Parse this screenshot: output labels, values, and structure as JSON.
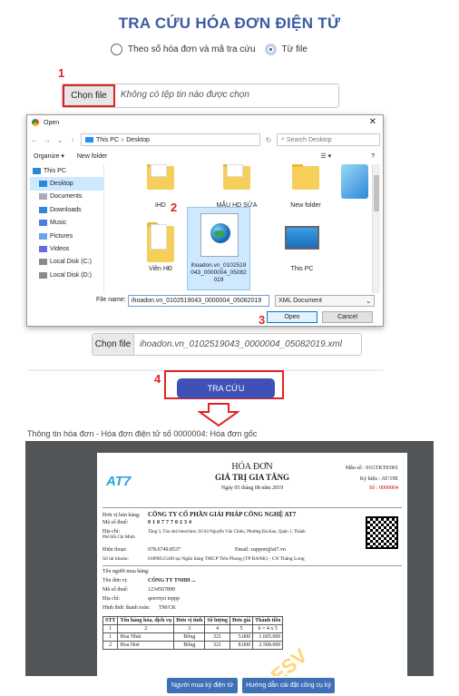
{
  "page": {
    "title": "TRA CỨU HÓA ĐƠN ĐIỆN TỬ",
    "radio_options": [
      "Theo số hóa đơn và mã tra cứu",
      "Từ file"
    ],
    "selected_radio": "Từ file"
  },
  "steps": {
    "s1": "1",
    "s2": "2",
    "s3": "3",
    "s4": "4"
  },
  "upload": {
    "button_label": "Chọn file",
    "placeholder": "Không có tệp tin nào được chọn",
    "selected_file": "ihoadon.vn_0102519043_0000004_05082019.xml"
  },
  "dialog": {
    "title": "Open",
    "path": [
      "This PC",
      "Desktop"
    ],
    "search_placeholder": "Search Desktop",
    "organize": "Organize ▾",
    "new_folder": "New folder",
    "sidebar": [
      "This PC",
      "Desktop",
      "Documents",
      "Downloads",
      "Music",
      "Pictures",
      "Videos",
      "Local Disk (C:)",
      "Local Disk (D:)"
    ],
    "files": {
      "f1": "iHD",
      "f2": "MẪU HD SỬA",
      "f3": "New folder",
      "f4": "Viền HĐ",
      "f5": "ihoadon.vn_0102519043_0000004_05082019",
      "f6": "This PC"
    },
    "file_name_label": "File name:",
    "file_name_value": "ihoadon.vn_0102519043_0000004_05082019",
    "file_type": "XML Document",
    "open_button": "Open",
    "cancel_button": "Cancel"
  },
  "search_button": "TRA CỨU",
  "info_text": "Thông tin hóa đơn - Hóa đơn điện tử số 0000004: Hóa đơn gốc",
  "invoice": {
    "title1": "HÓA ĐƠN",
    "title2": "GIÁ TRỊ GIA TĂNG",
    "date_line": "Ngày 05 tháng 08 năm 2019",
    "mau_so": "Mẫu số : 01GTKT0/001",
    "ky_hieu": "Ký hiệu : AT/19E",
    "so": "Số : 0000004",
    "logo": "AT7",
    "seller_unit_label": "Đơn vị bán hàng:",
    "seller_unit": "CÔNG TY CỔ PHẦN GIẢI PHÁP CÔNG NGHỆ AT7",
    "seller_tax_label": "Mã số thuế:",
    "seller_tax": "0107770234",
    "seller_addr_label": "Địa chỉ:",
    "seller_addr": "Tầng 3, Tòa nhà Intochine, Số 04 Nguyễn Văn Chiêu, Phường Đa Kao, Quận 1, Thành Phố Hồ Chí Minh",
    "seller_phone_label": "Điện thoại:",
    "seller_phone": "078.6749.8537",
    "seller_email_label": "Email:",
    "seller_email": "support@at7.vn",
    "seller_bank_label": "Số tài khoản:",
    "seller_bank": "0189851540l tại Ngân hàng TMCP Tiên Phong (TP BANK) - CN Thăng Long",
    "buyer_name_label": "Tên người mua hàng:",
    "buyer_unit_label": "Tên đơn vị:",
    "buyer_unit": "CÔNG TY TNHH ...",
    "buyer_tax_label": "Mã số thuế:",
    "buyer_tax": "1234567890",
    "buyer_addr_label": "Địa chỉ:",
    "buyer_addr": "qeerrtyu ioppp",
    "payment_label": "Hình thức thanh toán:",
    "payment": "TM/CK",
    "table_headers": [
      "STT",
      "Tên hàng hóa, dịch vụ",
      "Đơn vị tính",
      "Số lượng",
      "Đơn giá",
      "Thành tiền"
    ],
    "table_index": [
      "1",
      "2",
      "3",
      "4",
      "5",
      "6 = 4 x 5"
    ],
    "rows": [
      [
        "1",
        "Hoa Nhài",
        "Bông",
        "321",
        "5.000",
        "1.605.000"
      ],
      [
        "2",
        "Hoa Hoè",
        "Bông",
        "321",
        "8.000",
        "2.568.000"
      ]
    ],
    "watermark": "ESV"
  },
  "bottom_buttons": {
    "b1": "Người mua ký điện tử",
    "b2": "Hướng dẫn cài đặt công cụ ký"
  },
  "colors": {
    "accent": "#3f51b5",
    "title": "#3c5aa6",
    "highlight": "#e02424"
  }
}
